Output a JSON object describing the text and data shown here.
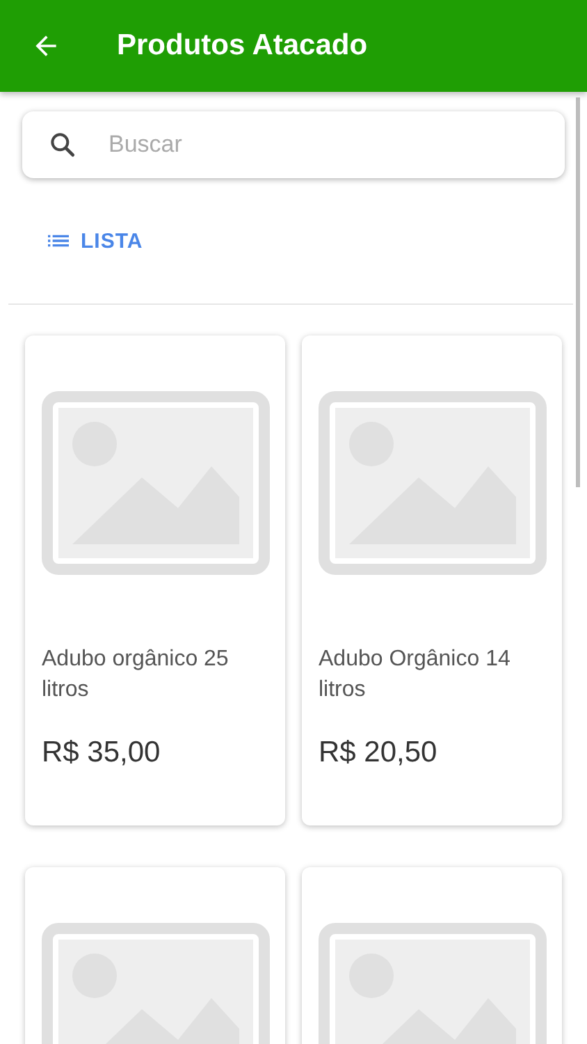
{
  "app_bar": {
    "title": "Produtos Atacado"
  },
  "search": {
    "placeholder": "Buscar"
  },
  "view_toggle": {
    "label": "LISTA"
  },
  "products": [
    {
      "kind": "product",
      "name": "Adubo orgânico 25 litros",
      "price": "R$ 35,00"
    },
    {
      "kind": "product",
      "name": "Adubo Orgânico 14 litros",
      "price": "R$ 20,50"
    },
    {
      "kind": "product"
    },
    {
      "kind": "product"
    }
  ]
}
